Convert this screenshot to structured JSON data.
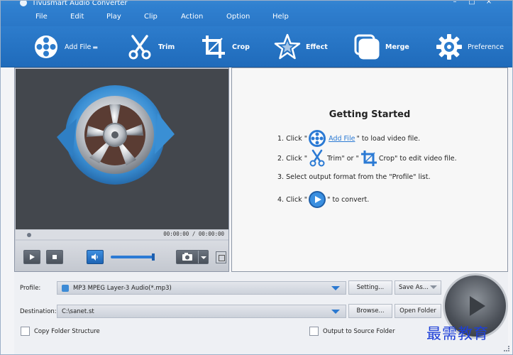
{
  "window": {
    "title": "Tivusmart Audio Converter",
    "buttons": [
      "–",
      "□",
      "×"
    ]
  },
  "menu": [
    {
      "label": "File"
    },
    {
      "label": "Edit"
    },
    {
      "label": "Play"
    },
    {
      "label": "Clip"
    },
    {
      "label": "Action"
    },
    {
      "label": "Option"
    },
    {
      "label": "Help"
    }
  ],
  "toolbar": {
    "add_file": "Add File",
    "trim": "Trim",
    "crop": "Crop",
    "effect": "Effect",
    "merge": "Merge",
    "preference": "Preference"
  },
  "player": {
    "timecode": "00:00:00 / 00:00:00",
    "seek_position": 0.0,
    "volume": 0.9
  },
  "getting_started": {
    "title": "Getting Started",
    "step1": {
      "prefix": "1. Click \"",
      "link": "Add File",
      "suffix": "\" to load video file."
    },
    "step2": {
      "prefix": "2. Click \"",
      "mid1": "Trim\" or \"",
      "suffix": "Crop\" to edit video file."
    },
    "step3": {
      "text": "3. Select output format from the \"Profile\" list."
    },
    "step4": {
      "prefix": "4. Click \"",
      "suffix": "\" to convert."
    }
  },
  "settings": {
    "profile_label": "Profile:",
    "profile_value": "MP3 MPEG Layer-3 Audio(*.mp3)",
    "setting_button": "Setting...",
    "save_as_button": "Save As...",
    "destination_label": "Destination:",
    "destination_value": "C:\\sanet.st",
    "browse_button": "Browse...",
    "open_folder_button": "Open Folder",
    "copy_folder_structure": "Copy Folder Structure",
    "output_to_source": "Output to Source Folder"
  },
  "watermark": "最需教育",
  "colors": {
    "accent": "#2a78d0",
    "toolbar": "#2d7ccc",
    "link": "#2b7ad4"
  }
}
